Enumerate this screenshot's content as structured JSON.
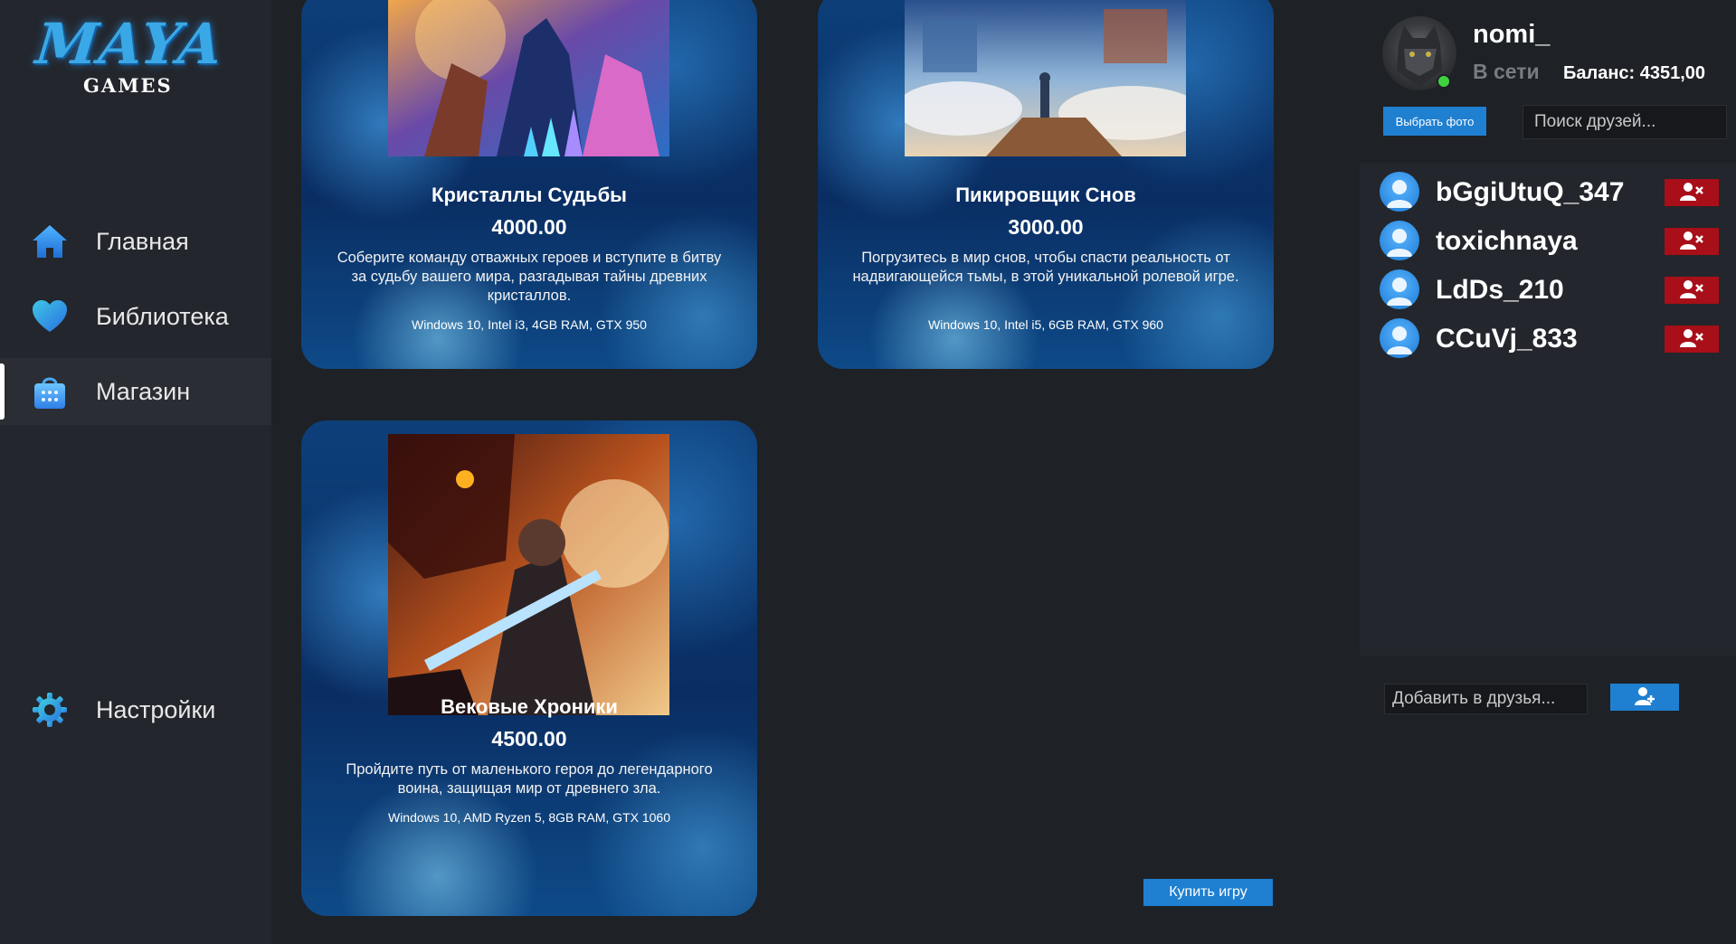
{
  "app": {
    "logo_main": "MAYA",
    "logo_sub": "GAMES"
  },
  "sidebar": {
    "items": [
      {
        "label": "Главная",
        "icon": "home-icon",
        "active": false
      },
      {
        "label": "Библиотека",
        "icon": "heart-icon",
        "active": false
      },
      {
        "label": "Магазин",
        "icon": "shopping-bag-icon",
        "active": true
      },
      {
        "label": "Настройки",
        "icon": "gear-icon",
        "active": false
      }
    ]
  },
  "store": {
    "games": [
      {
        "title": "Кристаллы Судьбы",
        "price": "4000.00",
        "description": "Соберите команду отважных героев и вступите в битву за судьбу вашего мира, разгадывая тайны древних кристаллов.",
        "requirements": "Windows 10, Intel i3, 4GB RAM, GTX 950"
      },
      {
        "title": "Пикировщик Снов",
        "price": "3000.00",
        "description": "Погрузитесь в мир снов, чтобы спасти реальность от надвигающейся тьмы, в этой уникальной ролевой игре.",
        "requirements": "Windows 10, Intel i5, 6GB RAM, GTX 960"
      },
      {
        "title": "Вековые Хроники",
        "price": "4500.00",
        "description": "Пройдите путь от маленького героя до легендарного воина, защищая мир от древнего зла.",
        "requirements": "Windows 10, AMD Ryzen 5, 8GB RAM, GTX 1060"
      }
    ],
    "buy_label": "Купить игру"
  },
  "profile": {
    "username": "nomi_",
    "status": "В сети",
    "balance": "Баланс: 4351,00",
    "choose_photo_label": "Выбрать фото",
    "search_placeholder": "Поиск друзей..."
  },
  "friends": [
    {
      "name": "bGgiUtuQ_347"
    },
    {
      "name": "toxichnaya"
    },
    {
      "name": "LdDs_210"
    },
    {
      "name": "CCuVj_833"
    }
  ],
  "add_friend": {
    "placeholder": "Добавить в друзья..."
  },
  "colors": {
    "accent": "#1f7fd0",
    "danger": "#a80f18",
    "online": "#3fd13f",
    "background": "#1e2126",
    "panel": "#23262c"
  }
}
